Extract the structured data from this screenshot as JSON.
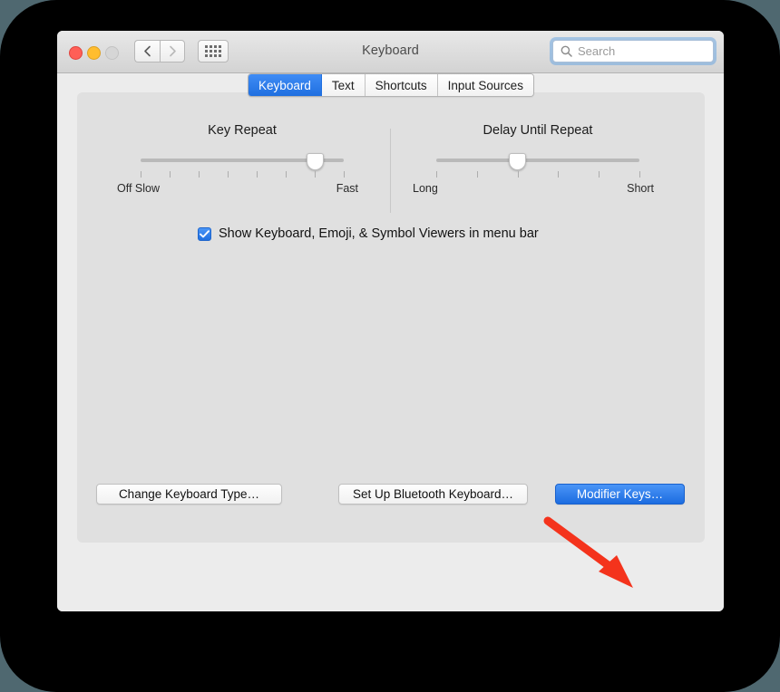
{
  "desktop": {
    "background_color": "#4f6870",
    "device_frame_color": "#000000"
  },
  "window": {
    "title": "Keyboard",
    "traffic_lights": {
      "close_label": "Close",
      "minimize_label": "Minimize",
      "maximize_label": "Zoom"
    },
    "nav": {
      "back_label": "Back",
      "forward_label": "Forward",
      "show_all_label": "Show All"
    },
    "search": {
      "placeholder": "Search",
      "value": "",
      "focused": true,
      "focus_ring_color": "#6ea8e1"
    }
  },
  "tabs": {
    "items": [
      {
        "label": "Keyboard",
        "active": true
      },
      {
        "label": "Text",
        "active": false
      },
      {
        "label": "Shortcuts",
        "active": false
      },
      {
        "label": "Input Sources",
        "active": false
      }
    ],
    "active_color": "#1f6fe0"
  },
  "sliders": {
    "key_repeat": {
      "title": "Key Repeat",
      "left_label": "Off Slow",
      "right_label": "Fast",
      "tick_count": 8,
      "value_index": 7,
      "value_percent": 86
    },
    "delay_until_repeat": {
      "title": "Delay Until Repeat",
      "left_label": "Long",
      "right_label": "Short",
      "tick_count": 6,
      "value_index": 3,
      "value_percent": 40
    }
  },
  "checkbox": {
    "label": "Show Keyboard, Emoji, & Symbol Viewers in menu bar",
    "checked": true,
    "color": "#1f6fe0"
  },
  "buttons": {
    "change_keyboard_type": "Change Keyboard Type…",
    "setup_bluetooth_keyboard": "Set Up Bluetooth Keyboard…",
    "modifier_keys": "Modifier Keys…",
    "modifier_keys_accent": "#1c6ce0",
    "help": "?"
  },
  "annotation": {
    "arrow_color": "#f4331c",
    "points_to": "Modifier Keys…"
  }
}
